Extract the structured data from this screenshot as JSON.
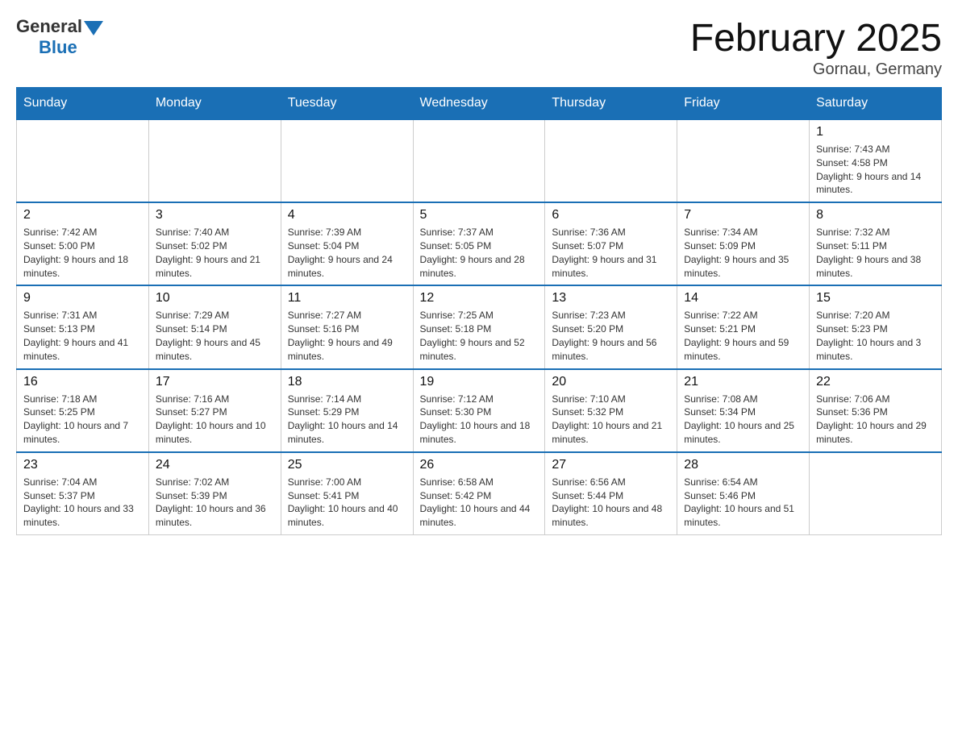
{
  "logo": {
    "general": "General",
    "blue": "Blue"
  },
  "title": "February 2025",
  "location": "Gornau, Germany",
  "days_of_week": [
    "Sunday",
    "Monday",
    "Tuesday",
    "Wednesday",
    "Thursday",
    "Friday",
    "Saturday"
  ],
  "weeks": [
    {
      "days": [
        {
          "number": "",
          "info": ""
        },
        {
          "number": "",
          "info": ""
        },
        {
          "number": "",
          "info": ""
        },
        {
          "number": "",
          "info": ""
        },
        {
          "number": "",
          "info": ""
        },
        {
          "number": "",
          "info": ""
        },
        {
          "number": "1",
          "info": "Sunrise: 7:43 AM\nSunset: 4:58 PM\nDaylight: 9 hours and 14 minutes."
        }
      ]
    },
    {
      "days": [
        {
          "number": "2",
          "info": "Sunrise: 7:42 AM\nSunset: 5:00 PM\nDaylight: 9 hours and 18 minutes."
        },
        {
          "number": "3",
          "info": "Sunrise: 7:40 AM\nSunset: 5:02 PM\nDaylight: 9 hours and 21 minutes."
        },
        {
          "number": "4",
          "info": "Sunrise: 7:39 AM\nSunset: 5:04 PM\nDaylight: 9 hours and 24 minutes."
        },
        {
          "number": "5",
          "info": "Sunrise: 7:37 AM\nSunset: 5:05 PM\nDaylight: 9 hours and 28 minutes."
        },
        {
          "number": "6",
          "info": "Sunrise: 7:36 AM\nSunset: 5:07 PM\nDaylight: 9 hours and 31 minutes."
        },
        {
          "number": "7",
          "info": "Sunrise: 7:34 AM\nSunset: 5:09 PM\nDaylight: 9 hours and 35 minutes."
        },
        {
          "number": "8",
          "info": "Sunrise: 7:32 AM\nSunset: 5:11 PM\nDaylight: 9 hours and 38 minutes."
        }
      ]
    },
    {
      "days": [
        {
          "number": "9",
          "info": "Sunrise: 7:31 AM\nSunset: 5:13 PM\nDaylight: 9 hours and 41 minutes."
        },
        {
          "number": "10",
          "info": "Sunrise: 7:29 AM\nSunset: 5:14 PM\nDaylight: 9 hours and 45 minutes."
        },
        {
          "number": "11",
          "info": "Sunrise: 7:27 AM\nSunset: 5:16 PM\nDaylight: 9 hours and 49 minutes."
        },
        {
          "number": "12",
          "info": "Sunrise: 7:25 AM\nSunset: 5:18 PM\nDaylight: 9 hours and 52 minutes."
        },
        {
          "number": "13",
          "info": "Sunrise: 7:23 AM\nSunset: 5:20 PM\nDaylight: 9 hours and 56 minutes."
        },
        {
          "number": "14",
          "info": "Sunrise: 7:22 AM\nSunset: 5:21 PM\nDaylight: 9 hours and 59 minutes."
        },
        {
          "number": "15",
          "info": "Sunrise: 7:20 AM\nSunset: 5:23 PM\nDaylight: 10 hours and 3 minutes."
        }
      ]
    },
    {
      "days": [
        {
          "number": "16",
          "info": "Sunrise: 7:18 AM\nSunset: 5:25 PM\nDaylight: 10 hours and 7 minutes."
        },
        {
          "number": "17",
          "info": "Sunrise: 7:16 AM\nSunset: 5:27 PM\nDaylight: 10 hours and 10 minutes."
        },
        {
          "number": "18",
          "info": "Sunrise: 7:14 AM\nSunset: 5:29 PM\nDaylight: 10 hours and 14 minutes."
        },
        {
          "number": "19",
          "info": "Sunrise: 7:12 AM\nSunset: 5:30 PM\nDaylight: 10 hours and 18 minutes."
        },
        {
          "number": "20",
          "info": "Sunrise: 7:10 AM\nSunset: 5:32 PM\nDaylight: 10 hours and 21 minutes."
        },
        {
          "number": "21",
          "info": "Sunrise: 7:08 AM\nSunset: 5:34 PM\nDaylight: 10 hours and 25 minutes."
        },
        {
          "number": "22",
          "info": "Sunrise: 7:06 AM\nSunset: 5:36 PM\nDaylight: 10 hours and 29 minutes."
        }
      ]
    },
    {
      "days": [
        {
          "number": "23",
          "info": "Sunrise: 7:04 AM\nSunset: 5:37 PM\nDaylight: 10 hours and 33 minutes."
        },
        {
          "number": "24",
          "info": "Sunrise: 7:02 AM\nSunset: 5:39 PM\nDaylight: 10 hours and 36 minutes."
        },
        {
          "number": "25",
          "info": "Sunrise: 7:00 AM\nSunset: 5:41 PM\nDaylight: 10 hours and 40 minutes."
        },
        {
          "number": "26",
          "info": "Sunrise: 6:58 AM\nSunset: 5:42 PM\nDaylight: 10 hours and 44 minutes."
        },
        {
          "number": "27",
          "info": "Sunrise: 6:56 AM\nSunset: 5:44 PM\nDaylight: 10 hours and 48 minutes."
        },
        {
          "number": "28",
          "info": "Sunrise: 6:54 AM\nSunset: 5:46 PM\nDaylight: 10 hours and 51 minutes."
        },
        {
          "number": "",
          "info": ""
        }
      ]
    }
  ]
}
